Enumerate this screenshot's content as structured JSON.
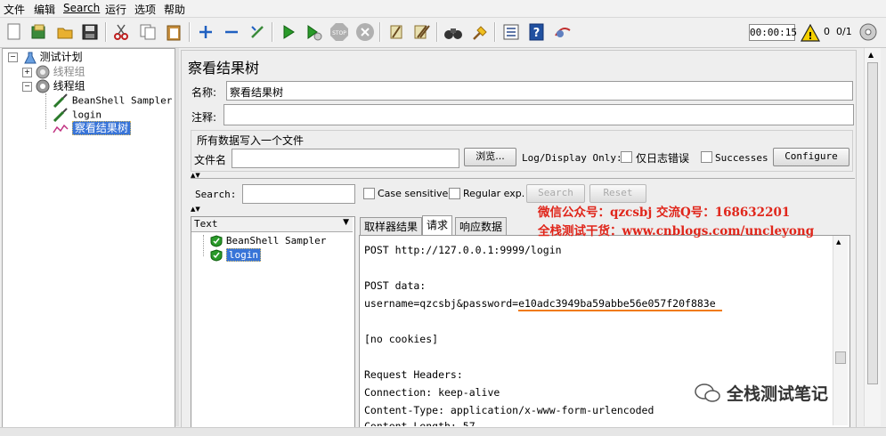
{
  "menu": [
    "文件",
    "编辑",
    "Search",
    "运行",
    "选项",
    "帮助"
  ],
  "toolbar": {
    "icons": [
      "new-icon",
      "open-templates-icon",
      "open-icon",
      "save-icon",
      "cut-icon",
      "copy-icon",
      "paste-icon",
      "expand-icon",
      "collapse-icon",
      "toggle-icon",
      "start-icon",
      "start-no-timers-icon",
      "stop-icon",
      "shutdown-icon",
      "clear-icon",
      "clear-all-icon",
      "search-icon",
      "reset-search-icon",
      "function-helper-icon",
      "help-icon",
      "remote-icon"
    ],
    "timer": "00:00:15",
    "warning_count": "0",
    "threads": "0/1"
  },
  "tree": {
    "root": "测试计划",
    "items": [
      {
        "label": "线程组",
        "level": 1
      },
      {
        "label": "线程组",
        "level": 1
      },
      {
        "label": "BeanShell Sampler",
        "level": 2
      },
      {
        "label": "login",
        "level": 2
      },
      {
        "label": "察看结果树",
        "level": 2
      }
    ]
  },
  "panel": {
    "title": "察看结果树",
    "name_label": "名称:",
    "name_value": "察看结果树",
    "comment_label": "注释:",
    "comment_value": "",
    "file_section_title": "所有数据写入一个文件",
    "file_label": "文件名",
    "file_value": "",
    "browse_label": "浏览...",
    "log_display_label": "Log/Display Only:",
    "errors_only_label": "仅日志错误",
    "successes_label": "Successes",
    "configure_label": "Configure"
  },
  "search": {
    "label": "Search:",
    "value": "",
    "case_sensitive_label": "Case sensitive",
    "regex_label": "Regular exp.",
    "search_button": "Search",
    "reset_button": "Reset"
  },
  "results": {
    "renderer": "Text",
    "samples": [
      {
        "label": "BeanShell Sampler",
        "status": "success"
      },
      {
        "label": "login",
        "status": "success",
        "selected": true
      }
    ],
    "tabs": [
      "取样器结果",
      "请求",
      "响应数据"
    ],
    "active_tab": "请求",
    "request_lines": [
      "POST http://127.0.0.1:9999/login",
      "",
      "POST data:",
      "username=qzcsbj&password=e10adc3949ba59abbe56e057f20f883e",
      "",
      "[no cookies]",
      "",
      "Request Headers:",
      "Connection: keep-alive",
      "Content-Type: application/x-www-form-urlencoded",
      "Content-Length: 57"
    ],
    "highlight_color": "#f07a10"
  },
  "watermark": {
    "line1": "微信公众号：qzcsbj   交流Q号：168632201",
    "line2": "全栈测试干货：www.cnblogs.com/uncleyong",
    "bottom": "全栈测试笔记",
    "color": "#e0261b"
  }
}
